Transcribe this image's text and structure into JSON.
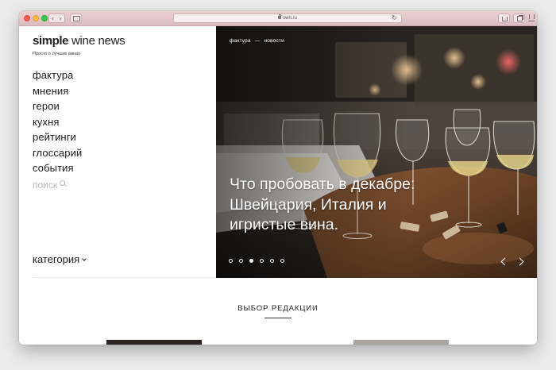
{
  "browser": {
    "url": "swn.ru"
  },
  "site": {
    "logo_bold": "simple",
    "logo_rest": " wine news",
    "tagline": "Просто о лучших винах"
  },
  "menu": {
    "items": [
      {
        "label": "фактура"
      },
      {
        "label": "мнения"
      },
      {
        "label": "герои"
      },
      {
        "label": "кухня"
      },
      {
        "label": "рейтинги"
      },
      {
        "label": "глоссарий"
      },
      {
        "label": "события"
      }
    ],
    "search_label": "поиск",
    "category_label": "категория"
  },
  "hero": {
    "breadcrumb": [
      "фактура",
      "новости"
    ],
    "title": "Что пробовать в декабре: Швейцария, Италия и игристые вина.",
    "slides_total": 6,
    "active_slide": 3
  },
  "section": {
    "title": "ВЫБОР РЕДАКЦИИ"
  },
  "colors": {
    "toolbar": "#e4c6c9",
    "text": "#1c1c1c",
    "muted": "#b7b7b7"
  }
}
